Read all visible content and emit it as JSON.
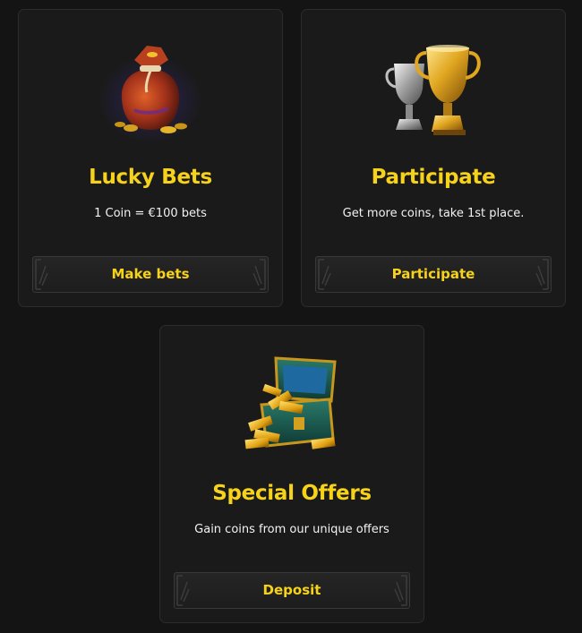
{
  "cards": [
    {
      "title": "Lucky Bets",
      "subtitle": "1 Coin = €100 bets",
      "button_label": "Make bets",
      "image_icon": "money-bag-icon"
    },
    {
      "title": "Participate",
      "subtitle": "Get more coins, take 1st place.",
      "button_label": "Participate",
      "image_icon": "trophy-cups-icon"
    },
    {
      "title": "Special Offers",
      "subtitle": "Gain coins from our unique offers",
      "button_label": "Deposit",
      "image_icon": "treasure-chest-icon"
    }
  ],
  "colors": {
    "background": "#141414",
    "card_background": "#1a1a1a",
    "accent": "#f7d21a",
    "text": "#f2f2f2"
  }
}
